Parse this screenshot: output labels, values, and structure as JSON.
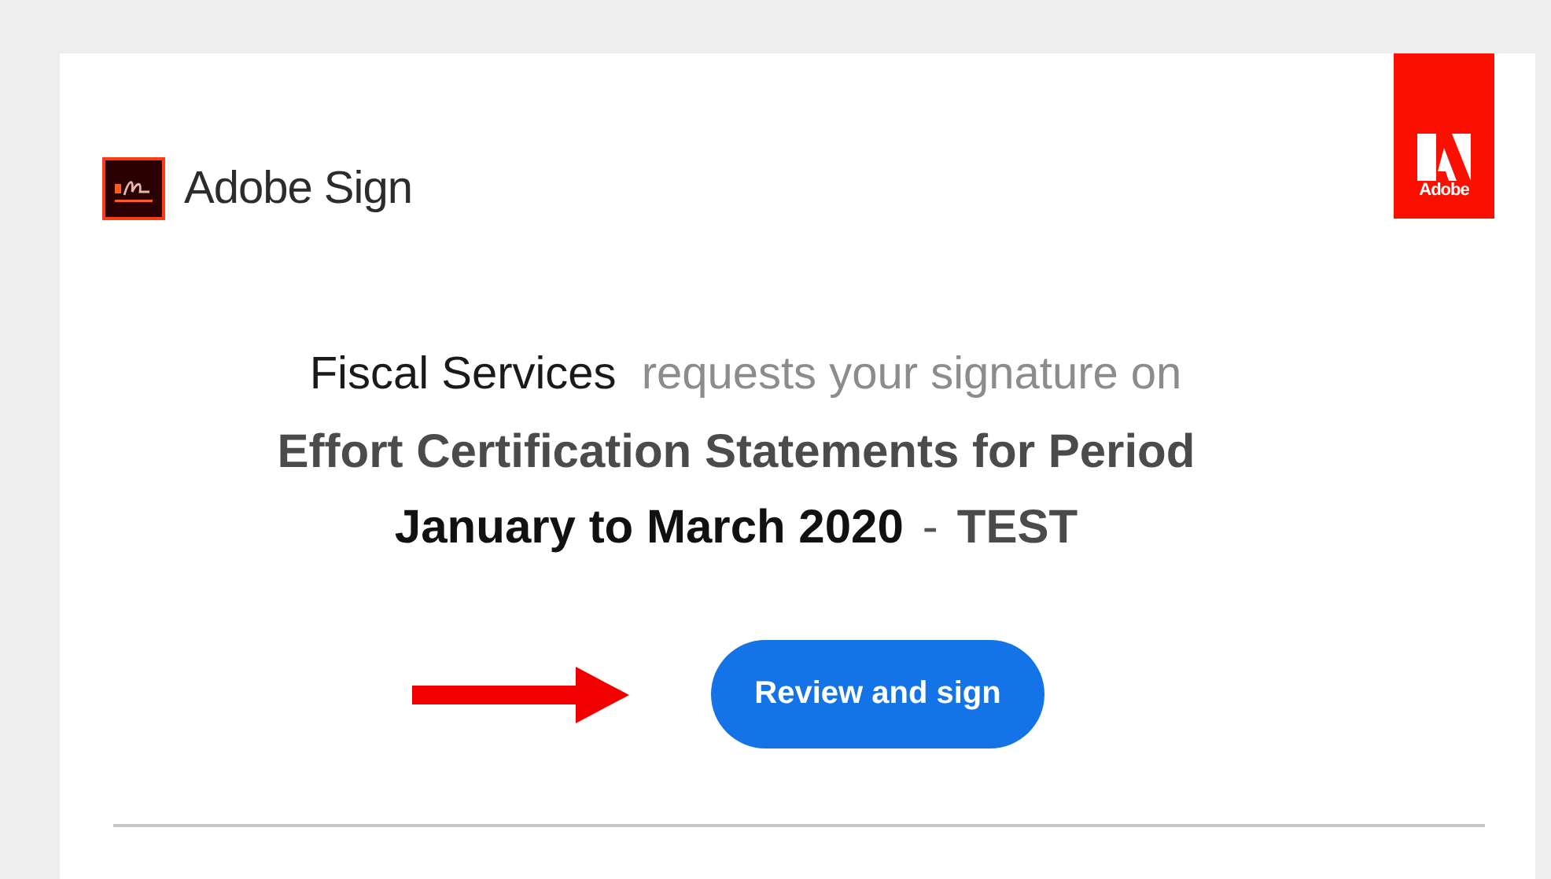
{
  "header": {
    "app_name": "Adobe Sign",
    "brand_logo": "Adobe"
  },
  "message": {
    "sender": "Fiscal Services",
    "request_text": "requests your signature on",
    "document_title": "Effort Certification Statements for Period",
    "period": "January to March 2020",
    "separator": "-",
    "tag": "TEST"
  },
  "action_button": {
    "label": "Review and sign"
  }
}
